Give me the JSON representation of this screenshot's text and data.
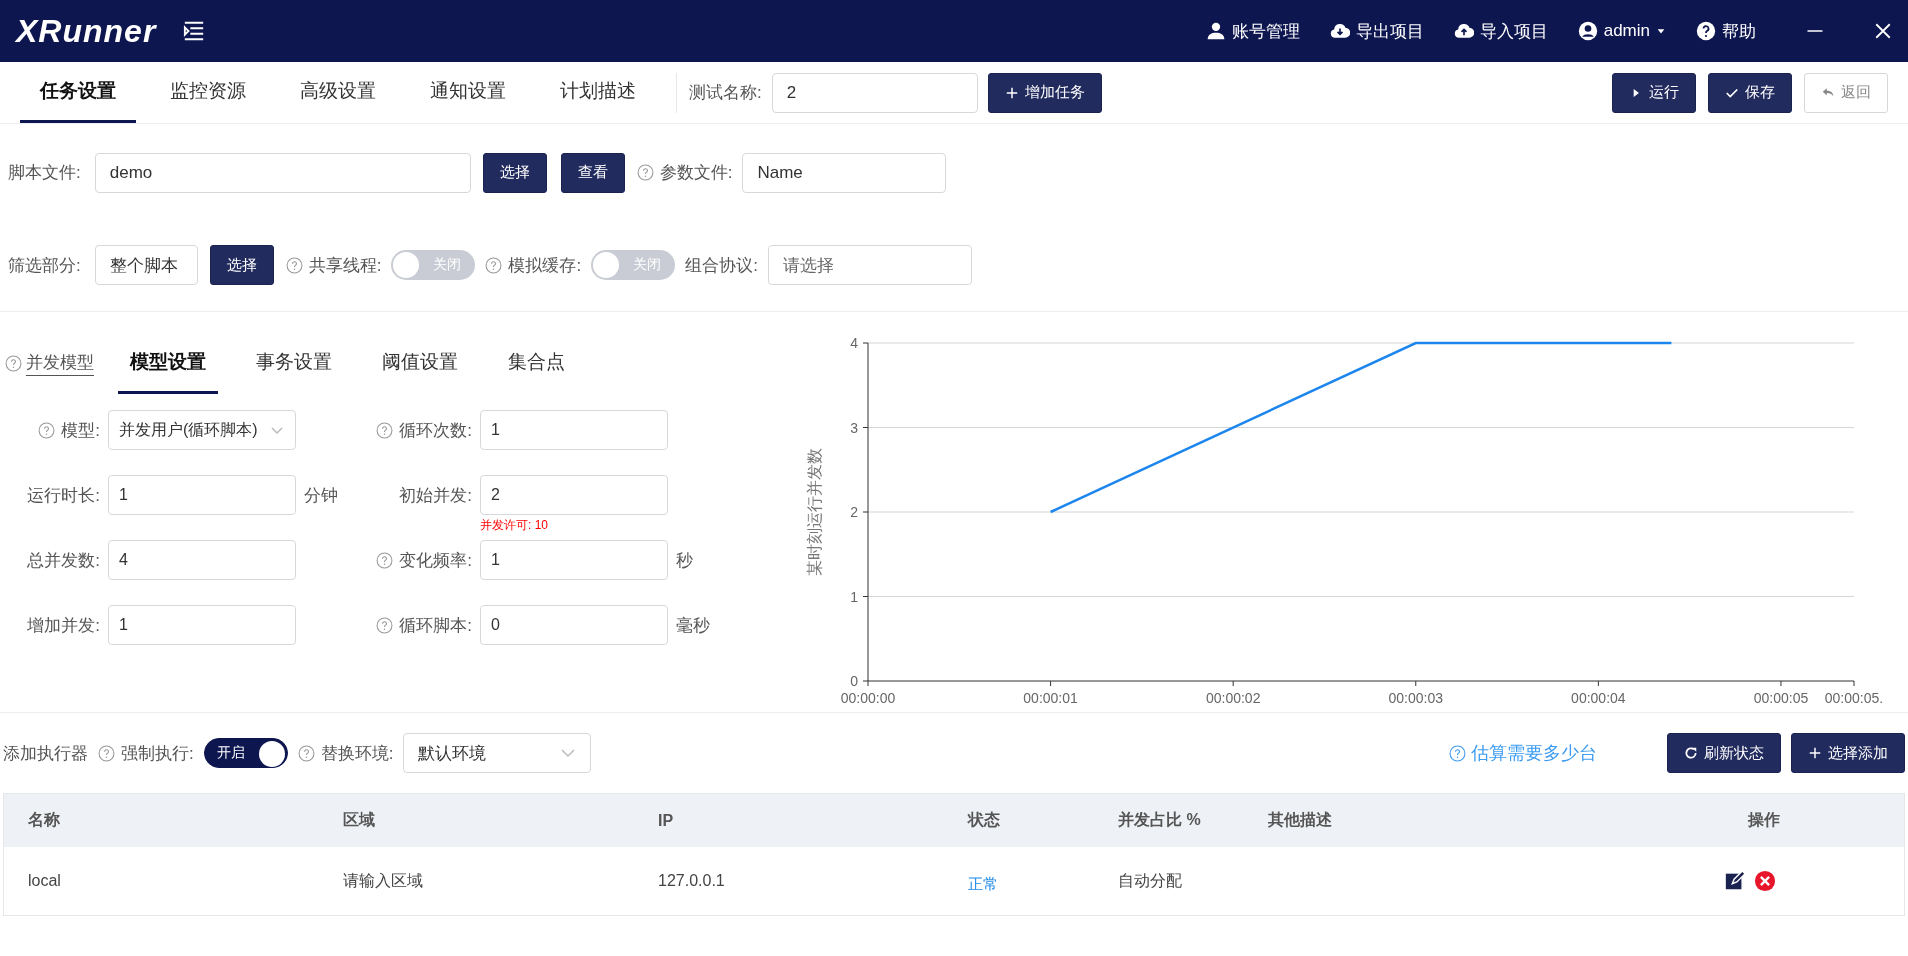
{
  "header": {
    "logo": "XRunner",
    "menu": [
      {
        "kind": "user",
        "label": "账号管理"
      },
      {
        "kind": "download",
        "label": "导出项目"
      },
      {
        "kind": "upload",
        "label": "导入项目"
      },
      {
        "kind": "account",
        "label": "admin"
      },
      {
        "kind": "help",
        "label": "帮助"
      }
    ]
  },
  "top_tabs": [
    {
      "label": "任务设置",
      "selected": true
    },
    {
      "label": "监控资源",
      "selected": false
    },
    {
      "label": "高级设置",
      "selected": false
    },
    {
      "label": "通知设置",
      "selected": false
    },
    {
      "label": "计划描述",
      "selected": false
    }
  ],
  "test_name": {
    "label": "测试名称:",
    "value": "2"
  },
  "add_task_button": "增加任务",
  "actions": [
    {
      "kind": "run",
      "label": "运行"
    },
    {
      "kind": "save",
      "label": "保存"
    },
    {
      "kind": "back",
      "label": "返回"
    }
  ],
  "form_rows": [
    [
      {
        "kind": "label",
        "text": "脚本文件:",
        "help": false
      },
      {
        "kind": "input",
        "value": "demo"
      },
      {
        "kind": "button",
        "text": "选择"
      },
      {
        "kind": "button",
        "text": "查看"
      },
      {
        "kind": "label",
        "text": "参数文件:",
        "help": true
      },
      {
        "kind": "input",
        "value": "Name"
      }
    ],
    [
      {
        "kind": "label",
        "text": "筛选部分:",
        "help": false
      },
      {
        "kind": "input",
        "value": "整个脚本"
      },
      {
        "kind": "button",
        "text": "选择"
      },
      {
        "kind": "label",
        "text": "共享线程:",
        "help": true
      },
      {
        "kind": "toggle",
        "on": false,
        "text": "关闭"
      },
      {
        "kind": "label",
        "text": "模拟缓存:",
        "help": true
      },
      {
        "kind": "toggle",
        "on": false,
        "text": "关闭"
      },
      {
        "kind": "label",
        "text": "组合协议:",
        "help": false
      },
      {
        "kind": "input",
        "placeholder": "请选择"
      }
    ]
  ],
  "model_help_link": "并发模型",
  "model_tabs": [
    {
      "label": "模型设置",
      "selected": true
    },
    {
      "label": "事务设置",
      "selected": false
    },
    {
      "label": "阈值设置",
      "selected": false
    },
    {
      "label": "集合点",
      "selected": false
    }
  ],
  "model_fields": [
    {
      "label": "模型:",
      "help": true,
      "kind": "select",
      "value": "并发用户(循环脚本)"
    },
    {
      "label": "循环次数:",
      "help": true,
      "kind": "input",
      "value": "1"
    },
    {
      "label": "运行时长:",
      "help": false,
      "kind": "input",
      "value": "1",
      "unit": "分钟"
    },
    {
      "label": "初始并发:",
      "help": false,
      "kind": "input",
      "value": "2",
      "note": "并发许可: 10"
    },
    {
      "label": "总并发数:",
      "help": false,
      "kind": "input",
      "value": "4"
    },
    {
      "label": "变化频率:",
      "help": true,
      "kind": "input",
      "value": "1",
      "unit": "秒"
    },
    {
      "label": "增加并发:",
      "help": false,
      "kind": "input",
      "value": "1"
    },
    {
      "label": "循环脚本:",
      "help": true,
      "kind": "input",
      "value": "0",
      "unit": "毫秒"
    }
  ],
  "chart_data": {
    "type": "line",
    "ylabel": "某时刻运行并发数",
    "x": [
      1,
      3,
      4.4
    ],
    "series": [
      {
        "color": "#1c86ee",
        "values": [
          2,
          4,
          4
        ]
      }
    ],
    "xlim": [
      0,
      5.4
    ],
    "ylim": [
      0,
      4
    ],
    "xticks": [
      {
        "value": 0,
        "label": "00:00:00"
      },
      {
        "value": 1,
        "label": "00:00:01"
      },
      {
        "value": 2,
        "label": "00:00:02"
      },
      {
        "value": 3,
        "label": "00:00:03"
      },
      {
        "value": 4,
        "label": "00:00:04"
      },
      {
        "value": 5,
        "label": "00:00:05"
      },
      {
        "value": 5.4,
        "label": "00:00:05."
      }
    ],
    "yticks": [
      0,
      1,
      2,
      3,
      4
    ],
    "grid": true
  },
  "executor_bar": {
    "title": "添加执行器",
    "force": {
      "label": "强制执行:",
      "on": true,
      "text": "开启"
    },
    "env": {
      "label": "替换环境:",
      "value": "默认环境"
    },
    "estimate_link": "估算需要多少台",
    "buttons": [
      {
        "kind": "refresh",
        "label": "刷新状态"
      },
      {
        "kind": "add",
        "label": "选择添加"
      }
    ]
  },
  "table": {
    "columns": [
      "名称",
      "区域",
      "IP",
      "状态",
      "并发占比 %",
      "其他描述",
      "操作"
    ],
    "rows": [
      {
        "name": "local",
        "region": "请输入区域",
        "ip": "127.0.0.1",
        "status": "正常",
        "share": "自动分配"
      }
    ]
  }
}
